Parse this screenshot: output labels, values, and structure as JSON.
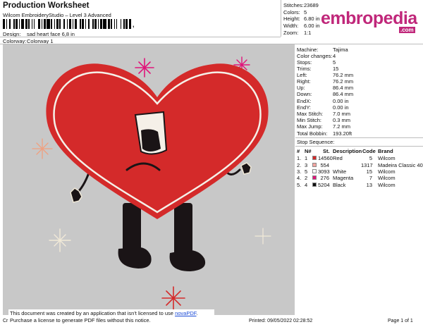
{
  "header": {
    "title": "Production Worksheet",
    "subtitle": "Wilcom EmbroideryStudio – Level 3 Advanced",
    "barcode_suffix": ",",
    "design_label": "Design:",
    "design_value": "sad heart face 6,8 in",
    "colorway_label": "Colorway:",
    "colorway_value": "Colorway 1"
  },
  "stats": [
    {
      "label": "Stitches:",
      "value": "23689"
    },
    {
      "label": "Colors:",
      "value": "5"
    },
    {
      "label": "Height:",
      "value": "6.80 in"
    },
    {
      "label": "Width:",
      "value": "6.00 in"
    },
    {
      "label": "Zoom:",
      "value": "1:1"
    }
  ],
  "logo": {
    "text": "embropedia",
    "tld": ".com",
    "color": "#c0277a"
  },
  "machine": [
    {
      "label": "Machine:",
      "value": "Tajima"
    },
    {
      "label": "Color changes:",
      "value": "4"
    },
    {
      "label": "Stops:",
      "value": "5"
    },
    {
      "label": "Trims:",
      "value": "15"
    },
    {
      "label": "Left:",
      "value": "76.2 mm"
    },
    {
      "label": "Right:",
      "value": "76.2 mm"
    },
    {
      "label": "Up:",
      "value": "86.4 mm"
    },
    {
      "label": "Down:",
      "value": "86.4 mm"
    },
    {
      "label": "EndX:",
      "value": "0.00 in"
    },
    {
      "label": "EndY:",
      "value": "0.00 in"
    },
    {
      "label": "Max Stitch:",
      "value": "7.0 mm"
    },
    {
      "label": "Min Stitch:",
      "value": "0.3 mm"
    },
    {
      "label": "Max Jump:",
      "value": "7.2 mm"
    },
    {
      "label": "Total Bobbin:",
      "value": "193.20ft"
    }
  ],
  "stop_sequence": {
    "title": "Stop Sequence:",
    "headers": {
      "n": "#",
      "n2": "N#",
      "color": "",
      "st": "St.",
      "description": "Description",
      "code": "Code",
      "brand": "Brand"
    },
    "rows": [
      {
        "n": "1.",
        "n2": "1",
        "color": "#d42a2a",
        "st": "14560",
        "description": "Red",
        "code": "5",
        "brand": "Wilcom"
      },
      {
        "n": "2.",
        "n2": "3",
        "color": "#f3a5a0",
        "st": "554",
        "description": "",
        "code": "1317",
        "brand": "Madeira Classic 40"
      },
      {
        "n": "3.",
        "n2": "5",
        "color": "#ffffff",
        "st": "3093",
        "description": "White",
        "code": "15",
        "brand": "Wilcom"
      },
      {
        "n": "4.",
        "n2": "2",
        "color": "#e0157a",
        "st": "276",
        "description": "Magenta",
        "code": "7",
        "brand": "Wilcom"
      },
      {
        "n": "5.",
        "n2": "4",
        "color": "#111111",
        "st": "5204",
        "description": "Black",
        "code": "13",
        "brand": "Wilcom"
      }
    ]
  },
  "notice": {
    "line1_prefix": "This document was created by an application that isn't licensed to use ",
    "link": "novaPDF",
    "line1_suffix": ".",
    "line2": "Purchase a license to generate PDF files without this notice."
  },
  "footer": {
    "left": "Cr",
    "printed": "Printed: 09/05/2022 02:28:52",
    "page": "Page 1 of 1"
  },
  "design_colors": {
    "heart": "#d42a2a",
    "outline": "#f5f0e8",
    "black": "#1a1416",
    "sparkle_pink": "#e0157a",
    "sparkle_peach": "#f0a080",
    "sparkle_cream": "#f2ead8",
    "canvas": "#c8c8c8"
  }
}
